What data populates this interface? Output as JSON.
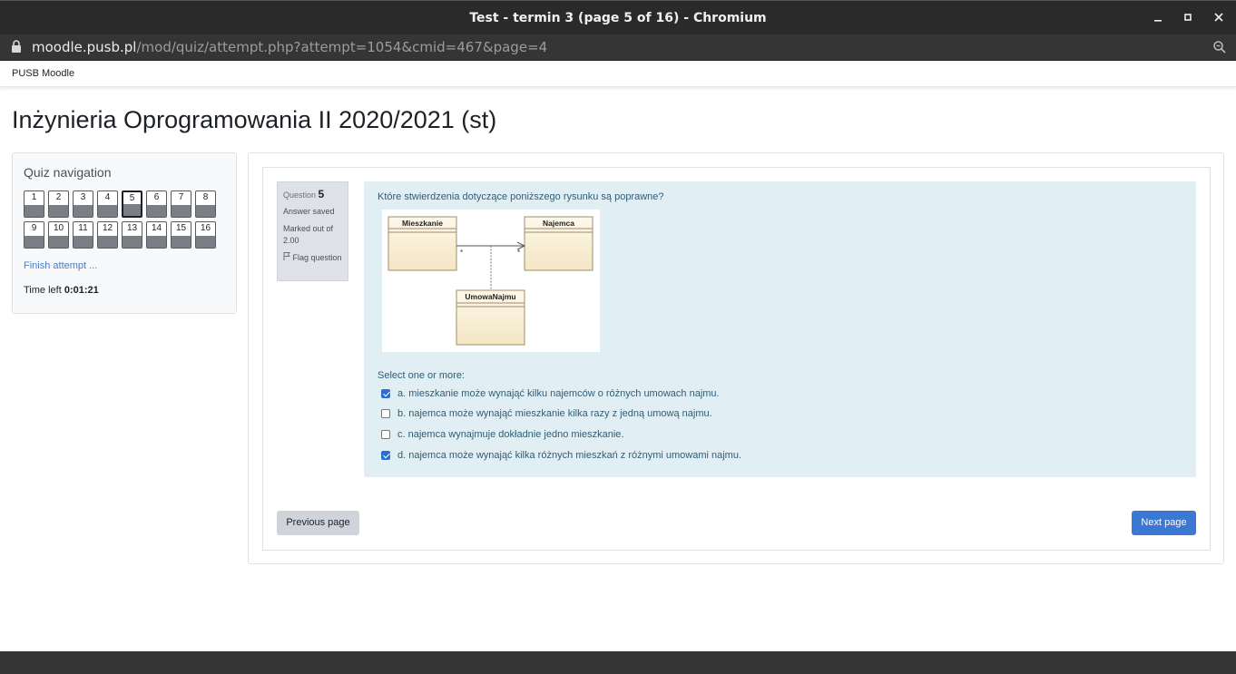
{
  "window": {
    "title": "Test - termin 3 (page 5 of 16) - Chromium"
  },
  "address": {
    "host": "moodle.pusb.pl",
    "path": "/mod/quiz/attempt.php?attempt=1054&cmid=467&page=4"
  },
  "navbar": {
    "brand": "PUSB Moodle"
  },
  "course": {
    "title": "Inżynieria Oprogramowania II 2020/2021 (st)"
  },
  "quiz_nav": {
    "heading": "Quiz navigation",
    "questions": [
      "1",
      "2",
      "3",
      "4",
      "5",
      "6",
      "7",
      "8",
      "9",
      "10",
      "11",
      "12",
      "13",
      "14",
      "15",
      "16"
    ],
    "current": "5",
    "finish_label": "Finish attempt ...",
    "time_label": "Time left",
    "time_value": "0:01:21"
  },
  "question": {
    "label": "Question",
    "number": "5",
    "state": "Answer saved",
    "marked_out": "Marked out of 2.00",
    "flag": "Flag question",
    "text": "Które stwierdzenia dotyczące poniższego rysunku są poprawne?",
    "diagram": {
      "class_a": "Mieszkanie",
      "class_b": "Najemca",
      "class_c": "UmowaNajmu",
      "mult_a": "*",
      "mult_b": "*"
    },
    "prompt": "Select one or more:",
    "options": [
      {
        "label": "a. mieszkanie może wynająć kilku najemców o różnych umowach najmu.",
        "checked": true
      },
      {
        "label": "b. najemca może wynająć mieszkanie kilka razy z jedną umową najmu.",
        "checked": false
      },
      {
        "label": "c. najemca wynajmuje dokładnie jedno mieszkanie.",
        "checked": false
      },
      {
        "label": "d. najemca może wynająć kilka różnych mieszkań z różnymi umowami najmu.",
        "checked": true
      }
    ]
  },
  "buttons": {
    "previous": "Previous page",
    "next": "Next page"
  },
  "colors": {
    "accent": "#3b78d3",
    "question_bg": "#e1eff5",
    "link": "#4a7dc4"
  }
}
